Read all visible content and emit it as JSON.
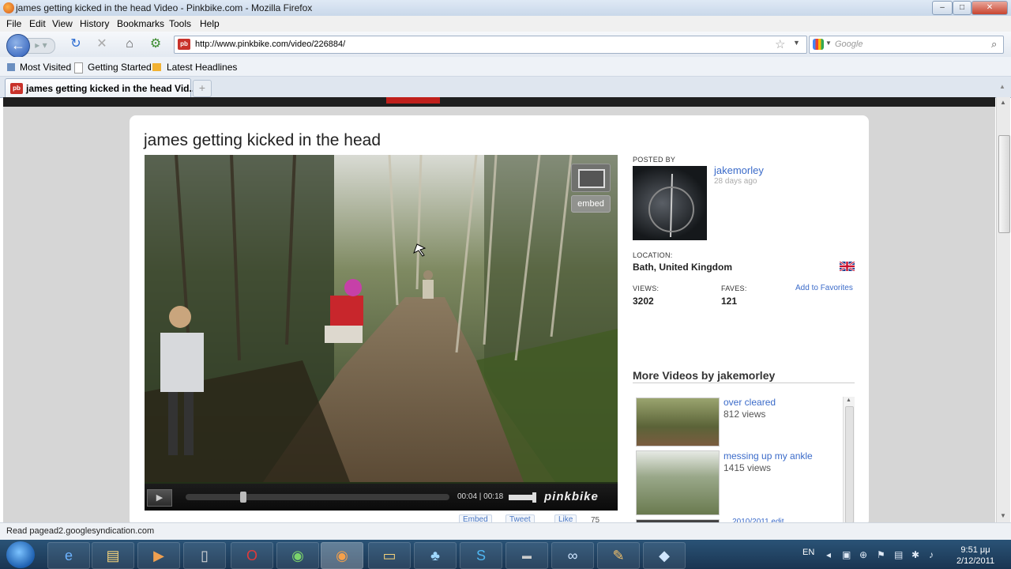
{
  "window": {
    "title": "james getting kicked in the head Video - Pinkbike.com - Mozilla Firefox",
    "minimize": "–",
    "maximize": "□",
    "close": "✕"
  },
  "menu": [
    "File",
    "Edit",
    "View",
    "History",
    "Bookmarks",
    "Tools",
    "Help"
  ],
  "navbar": {
    "url": "http://www.pinkbike.com/video/226884/",
    "search_placeholder": "Google",
    "favicon_text": "pb"
  },
  "bookmarks": [
    {
      "label": "Most Visited"
    },
    {
      "label": "Getting Started"
    },
    {
      "label": "Latest Headlines"
    }
  ],
  "tabs": [
    {
      "label": "james getting kicked in the head Vid..."
    }
  ],
  "page": {
    "video_title": "james getting kicked in the head",
    "player": {
      "time": "00:04 | 00:18",
      "progress": 0.22,
      "logo": "pinkbike",
      "embed_label": "embed"
    },
    "posted_by_label": "POSTED BY",
    "username": "jakemorley",
    "posted_ago": "28 days ago",
    "location_label": "LOCATION:",
    "location": "Bath, United Kingdom",
    "views_label": "VIEWS:",
    "views": "3202",
    "faves_label": "FAVES:",
    "faves": "121",
    "add_favorites": "Add to Favorites",
    "more_videos_title": "More Videos by jakemorley",
    "more_videos": [
      {
        "title": "over cleared",
        "views": "812 views"
      },
      {
        "title": "messing up my ankle",
        "views": "1415 views"
      },
      {
        "title": "... 2010/2011 edit ...",
        "views": ""
      }
    ],
    "share": {
      "embed": "Embed",
      "tweet": "Tweet",
      "like": "Like",
      "like_count": "75"
    }
  },
  "status": "Read pagead2.googlesyndication.com",
  "taskbar": {
    "lang": "EN",
    "time": "9:51 μμ",
    "date": "2/12/2011"
  },
  "colors": {
    "link": "#3b6bc9",
    "brand_red": "#c0201b",
    "taskbar": "#1f3f60"
  }
}
